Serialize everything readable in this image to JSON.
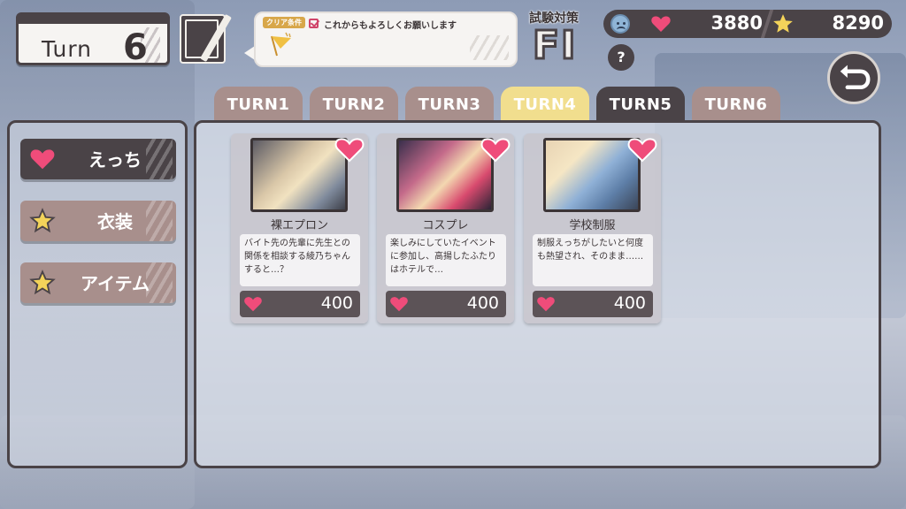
{
  "hud": {
    "turn_label": "Turn",
    "turn_number": "6",
    "clear_condition_tag": "クリア条件",
    "clear_condition_text": "これからもよろしくお願いします",
    "exam_title": "試験対策",
    "exam_rank": "FI",
    "love_points": "3880",
    "star_points": "8290",
    "help_label": "?"
  },
  "tabs": [
    {
      "label": "TURN1"
    },
    {
      "label": "TURN2"
    },
    {
      "label": "TURN3"
    },
    {
      "label": "TURN4"
    },
    {
      "label": "TURN5"
    },
    {
      "label": "TURN6"
    }
  ],
  "categories": [
    {
      "label": "えっち",
      "icon": "heart-icon"
    },
    {
      "label": "衣装",
      "icon": "star-icon"
    },
    {
      "label": "アイテム",
      "icon": "star-icon"
    }
  ],
  "cards": [
    {
      "title": "裸エプロン",
      "desc": "バイト先の先輩に先生との関係を相談する綾乃ちゃんすると…？",
      "price": "400"
    },
    {
      "title": "コスプレ",
      "desc": "楽しみにしていたイベントに参加し、高揚したふたりはホテルで…",
      "price": "400"
    },
    {
      "title": "学校制服",
      "desc": "制服えっちがしたいと何度も熱望され、そのまま……",
      "price": "400"
    }
  ],
  "colors": {
    "panel_border": "#4a4347",
    "tab_inactive": "#a88f8c",
    "tab_active": "#f1de8e",
    "heart_pink": "#ef4c7a",
    "star_yellow": "#f3d35a"
  }
}
